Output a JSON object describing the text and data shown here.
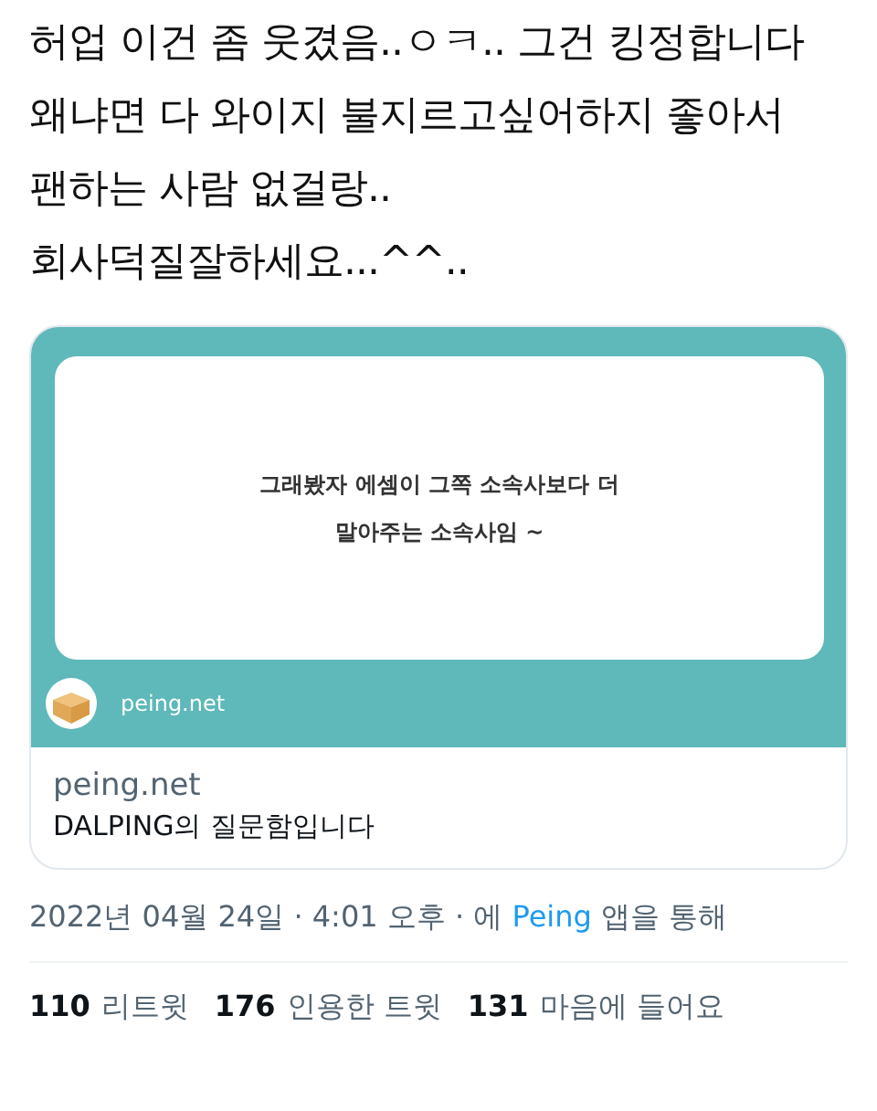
{
  "tweet_text": "허업 이건 좀 웃겼음..ㅇㅋ.. 그건 킹정합니다\n왜냐면 다 와이지 불지르고싶어하지 좋아서\n팬하는 사람 없걸랑..\n회사덕질잘하세요...^^..",
  "link_card": {
    "question_lines": [
      "그래봤자 에셈이 그쪽 소속사보다 더",
      "말아주는 소속사임 ~"
    ],
    "footer_site": "peing.net",
    "domain": "peing.net",
    "title": "DALPING의 질문함입니다"
  },
  "meta": {
    "date": "2022년 04월 24일",
    "separator": "·",
    "time": "4:01 오후",
    "via_prefix": "에",
    "source": "Peing",
    "via_suffix": "앱을 통해"
  },
  "stats": [
    {
      "count": "110",
      "label": "리트윗"
    },
    {
      "count": "176",
      "label": "인용한 트윗"
    },
    {
      "count": "131",
      "label": "마음에 들어요"
    }
  ]
}
